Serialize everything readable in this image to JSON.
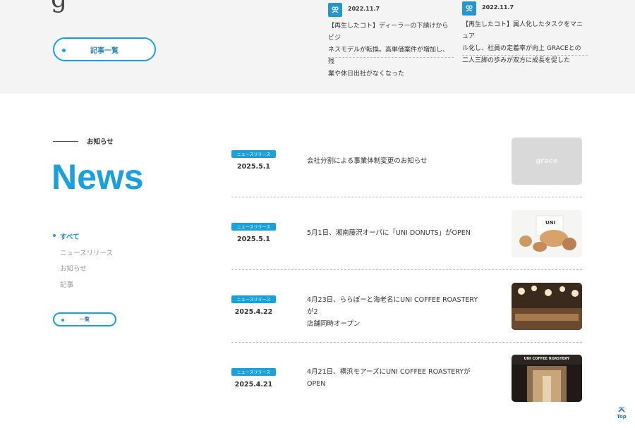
{
  "header": {
    "partial_glyph": "g",
    "list_button_label": "記事一覧"
  },
  "articles": [
    {
      "date": "2022.11.7",
      "lines": [
        "【再生したコト】ディーラーの下請けからビジ",
        "ネスモデルが転換。高単価案件が増加し、残",
        "業や休日出社がなくなった"
      ],
      "icon": "people-icon"
    },
    {
      "date": "2022.11.7",
      "lines": [
        "【再生したコト】属人化したタスクをマニュア",
        "ル化し、社員の定着率が向上 GRACEとの",
        "二人三脚の歩みが双方に成長を促した"
      ],
      "icon": "people-icon"
    }
  ],
  "news": {
    "label": "お知らせ",
    "heading": "News",
    "filters": [
      "すべて",
      "ニュースリリース",
      "お知らせ",
      "記事"
    ],
    "active_filter": "すべて",
    "list_button_label": "一覧",
    "items": [
      {
        "tag": "ニュースリリース",
        "date": "2025.5.1",
        "lines": [
          "会社分割による事業体制変更のお知らせ"
        ],
        "thumb_text": "grace"
      },
      {
        "tag": "ニュースリリース",
        "date": "2025.5.1",
        "lines": [
          "5月1日、湘南藤沢オーパに「UNI DONUTS」がOPEN"
        ],
        "thumb_text": "UNI"
      },
      {
        "tag": "ニュースリリース",
        "date": "2025.4.22",
        "lines": [
          "4月23日、ららぽーと海老名にUNI COFFEE ROASTERYが2",
          "店舗同時オープン"
        ],
        "thumb_text": ""
      },
      {
        "tag": "ニュースリリース",
        "date": "2025.4.21",
        "lines": [
          "4月21日、横浜モアーズにUNI COFFEE ROASTERYが",
          "OPEN"
        ],
        "thumb_text": "UNI COFFEE ROASTERY"
      }
    ]
  },
  "top_button": {
    "label": "Top"
  },
  "colors": {
    "accent": "#1aa1dc",
    "band": "#f4f4f4"
  }
}
